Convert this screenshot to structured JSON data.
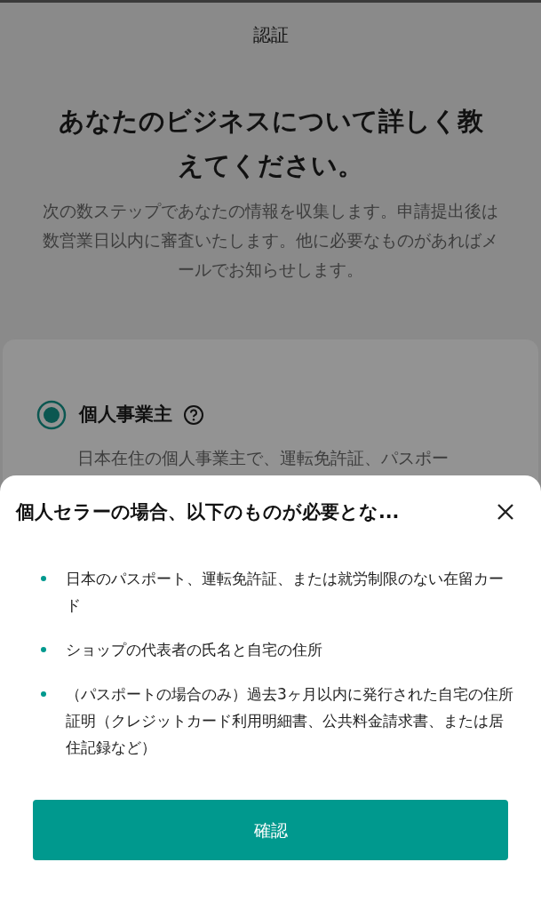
{
  "header": {
    "title": "認証"
  },
  "heading": "あなたのビジネスについて詳しく教えてください。",
  "intro": "次の数ステップであなたの情報を収集します。申請提出後は数営業日以内に審査いたします。他に必要なものがあればメールでお知らせします。",
  "options": [
    {
      "label": "個人事業主",
      "selected": true,
      "description": "日本在住の個人事業主で、運転免許証、パスポー"
    }
  ],
  "sheet": {
    "title": "個人セラーの場合、以下のものが必要とな...",
    "items": [
      "日本のパスポート、運転免許証、または就労制限のない在留カード",
      "ショップの代表者の氏名と自宅の住所",
      "（パスポートの場合のみ）過去3ヶ月以内に発行された自宅の住所証明（クレジットカード利用明細書、公共料金請求書、または居住記録など）"
    ],
    "button": "確認"
  }
}
